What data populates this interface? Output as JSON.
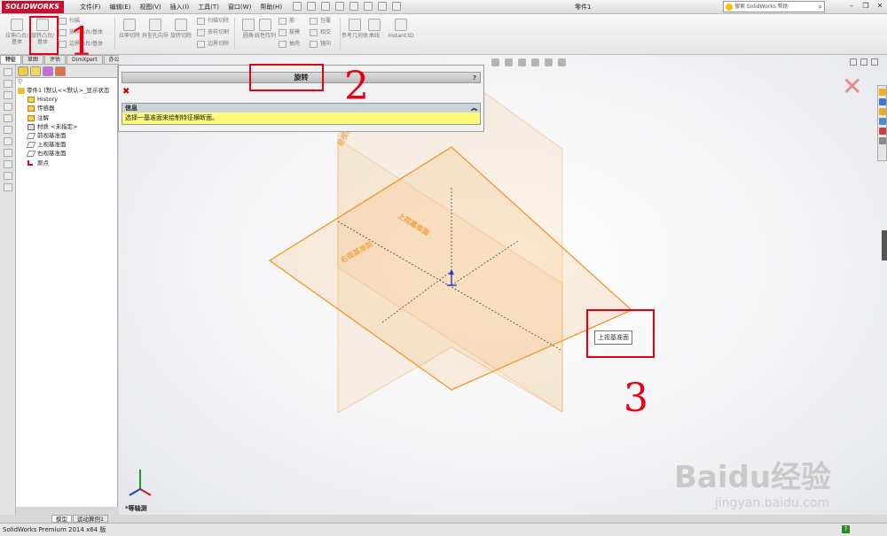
{
  "app": {
    "logo_text": "SOLIDWORKS",
    "document_title": "零件1",
    "search_placeholder": "搜索 SolidWorks 帮助",
    "menu": [
      "文件(F)",
      "编辑(E)",
      "视图(V)",
      "插入(I)",
      "工具(T)",
      "窗口(W)",
      "帮助(H)"
    ]
  },
  "ribbon": {
    "extrude_boss": "拉伸凸台/基体",
    "revolve_boss": "旋转凸台/基体",
    "sweep": "扫描",
    "loft_boss": "放样凸台/基体",
    "boundary_boss": "边界凸台/基体",
    "extrude_cut": "拉伸切除",
    "hole_wizard": "异型孔向导",
    "revolve_cut": "旋转切除",
    "swept_cut": "扫描切除",
    "lofted_cut": "放样切割",
    "boundary_cut": "边界切除",
    "fillet": "圆角",
    "linear_pattern": "线性阵列",
    "rib": "筋",
    "draft": "拔模",
    "shell": "抽壳",
    "wrap": "包覆",
    "intersect": "相交",
    "mirror": "镜向",
    "ref_geometry": "参考几何体",
    "curves": "曲线",
    "instant3d": "Instant3D"
  },
  "cm_tabs": [
    "特征",
    "草图",
    "评估",
    "DimXpert",
    "办公室产品"
  ],
  "feature_tree": {
    "root": "零件1 (默认<<默认>_显示状态",
    "items": [
      "History",
      "传感器",
      "注解",
      "材质 <未指定>",
      "前视基准面",
      "上视基准面",
      "右视基准面",
      "原点"
    ]
  },
  "property_manager": {
    "title": "旋转",
    "message_header": "信息",
    "message": "选择一基准面来绘制特征横断面。"
  },
  "viewport": {
    "front_plane_label": "前视基准面",
    "top_plane_label": "上视基准面",
    "right_plane_label": "右视基准面",
    "tooltip": "上视基准面",
    "triad_label": "*等轴测"
  },
  "bottom_tabs": [
    "模型",
    "运动算例1"
  ],
  "status": {
    "text": "SolidWorks Premium 2014 x64 版"
  },
  "annotations": [
    "1",
    "2",
    "3"
  ],
  "watermark": {
    "text": "Baidu经验",
    "url_text": "jingyan.baidu.com"
  },
  "colors": {
    "accent_red": "#e60012",
    "plane_orange": "#f0962a",
    "message_yellow": "#fbf97a"
  }
}
